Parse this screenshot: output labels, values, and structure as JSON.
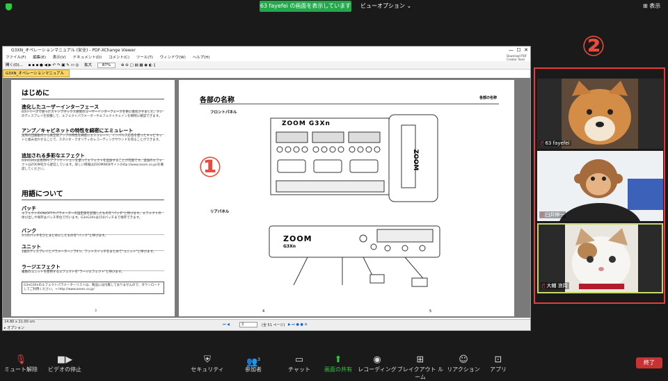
{
  "topbar": {
    "share_text": "63 fayefei の画面を表示しています",
    "view_options": "ビューオプション ⌄",
    "display_label": "表示"
  },
  "pdf": {
    "title": "G3XN_オペレーションマニュアル (安全) - PDF-XChange Viewer",
    "menu": [
      "ファイル(F)",
      "編集(E)",
      "表示(V)",
      "ドキュメント(D)",
      "コメント(C)",
      "ツール(T)",
      "ウィンドウ(W)",
      "ヘルプ(H)"
    ],
    "toolbar": {
      "open": "開く(O)...",
      "zoom_label": "拡大",
      "zoom_value": "87%",
      "download": "Download PDF Creator Tools"
    },
    "tab": "G3XN_オペレーションマニュアル (安全)",
    "left_page": {
      "h_intro": "はじめに",
      "s1": "進化したユーザーインターフェース",
      "s1_text": "G3シリーズで培ったストンプボックス感覚のユーザーインターフェースを更に進化させました。3つのディスプレイを装備して、エフェクトパラメーターやエフェクトチェインを瞬時に確認できます。",
      "s2": "アンプ／キャビネットの特性を綿密にエミュレート",
      "s2_text": "実際の回路動作から真空管アンプの特性を綿密にエミュレート。インパルス応答を使ったキャビネットと組み合わせることで、スタジオ・クオリティのレコーディングサウンドを得ることができます。",
      "s3": "追加される多彩なエフェクト",
      "s3_text": "G3nG3Xnは専用PCアプリケーションを使ってエフェクトを追加することが可能です。追加のエフェクトはZOOM社から配信しています。詳しい情報はZOOMWEBサイト(http://www.zoom.co.jp)を確認してください。",
      "h_terms": "用語について",
      "t1": "パッチ",
      "t1_text": "エフェクトのON/OFFやパラメーターの設定値を記憶したものを\"パッチ\"と呼びます。エフェクトの呼び出しや保存はパッチ単位で行います。G3nG3Xnは150パッチまで保存できます。",
      "t2": "バンク",
      "t2_text": "3つのパッチをひとまとめにしたものを\"バンク\"と呼びます。",
      "t3": "ユニット",
      "t3_text": "1組のディスプレイとパラメーターノブ4つ、フットスイッチをまとめて\"ユニット\"と呼びます。",
      "t4": "ラージエフェクト",
      "t4_text": "複数のユニットを使用するエフェクトを\"ラージエフェクト\"と呼びます。",
      "note": "G3nG3Xnのエフェクトパラメーターリストは、製品には付属しておりませんので、ダウンロードしてご利用ください。→ http://www.zoom.co.jp/",
      "page_no": "3"
    },
    "right_page": {
      "title": "各部の名称",
      "header_right": "各部の名称",
      "front": "フロントパネル",
      "rear": "リアパネル",
      "brand": "ZOOM G3Xn",
      "rear_brand": "ZOOM",
      "rear_model": "G3Xn",
      "page_no_l": "4",
      "page_no_r": "5"
    },
    "status": {
      "size": "14.80 x 21.00 cm",
      "options": "オプション",
      "page_current": "3",
      "page_total": "(全 51 ページ)"
    }
  },
  "overlay": {
    "marker1": "①",
    "marker2": "②"
  },
  "participants": [
    {
      "name": "63 fayefei",
      "color": "#c98a4a"
    },
    {
      "name": "臼井伸一",
      "color": "#5a7da3"
    },
    {
      "name": "大輔 浪岡",
      "color": "#c9c2b5"
    }
  ],
  "bottom": {
    "mute": "ミュート解除",
    "video": "ビデオの停止",
    "security": "セキュリティ",
    "participants": "参加者",
    "participant_count": "3",
    "chat": "チャット",
    "share": "画面の共有",
    "record": "レコーディング",
    "breakout": "ブレイクアウト ルーム",
    "reaction": "リアクション",
    "apps": "アプリ",
    "end": "終了"
  }
}
